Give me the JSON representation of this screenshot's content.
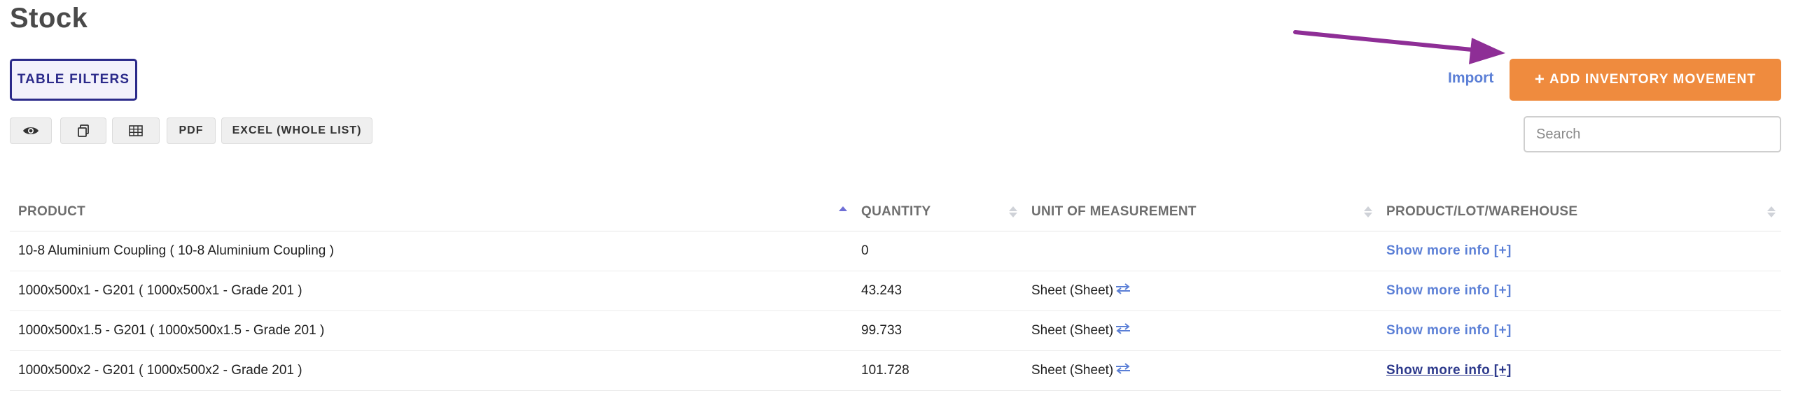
{
  "page": {
    "title": "Stock"
  },
  "filters": {
    "table_filters_label": "TABLE FILTERS"
  },
  "toolbar": {
    "view_icon": "eye-icon",
    "copy_icon": "copy-icon",
    "columns_icon": "table-grid-icon",
    "pdf_label": "PDF",
    "excel_label": "EXCEL (WHOLE LIST)"
  },
  "actions": {
    "import_label": "Import",
    "add_icon": "plus-icon",
    "add_label": "ADD INVENTORY MOVEMENT",
    "annotation_color": "#8e2e96"
  },
  "search": {
    "placeholder": "Search",
    "value": ""
  },
  "table": {
    "columns": [
      {
        "label": "PRODUCT",
        "sort": "asc"
      },
      {
        "label": "QUANTITY",
        "sort": "none"
      },
      {
        "label": "UNIT OF MEASUREMENT",
        "sort": "none"
      },
      {
        "label": "PRODUCT/LOT/WAREHOUSE",
        "sort": "none"
      }
    ],
    "rows": [
      {
        "product": "10-8 Aluminium Coupling ( 10-8 Aluminium Coupling )",
        "quantity": "0",
        "unit": "",
        "more": "Show more info [+]"
      },
      {
        "product": "1000x500x1 - G201 ( 1000x500x1 - Grade 201 )",
        "quantity": "43.243",
        "unit": "Sheet (Sheet)",
        "more": "Show more info [+]"
      },
      {
        "product": "1000x500x1.5 - G201 ( 1000x500x1.5 - Grade 201 )",
        "quantity": "99.733",
        "unit": "Sheet (Sheet)",
        "more": "Show more info [+]"
      },
      {
        "product": "1000x500x2 - G201 ( 1000x500x2 - Grade 201 )",
        "quantity": "101.728",
        "unit": "Sheet (Sheet)",
        "more": "Show more info [+]"
      }
    ]
  },
  "colors": {
    "accent_orange": "#ef8b3e",
    "link_blue": "#5b7fd6",
    "filter_border": "#2b2a8a",
    "zero_red": "#d9342b"
  }
}
